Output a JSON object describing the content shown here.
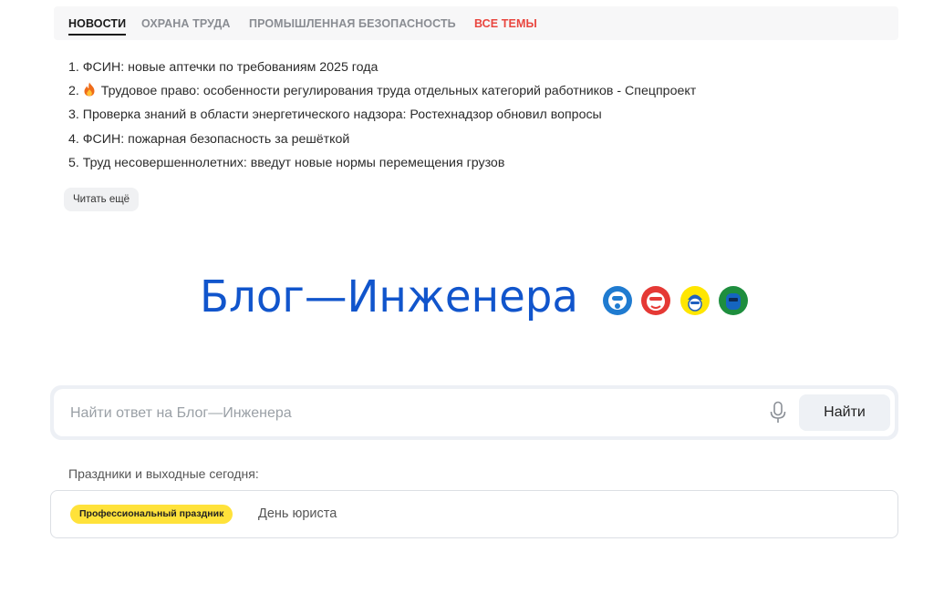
{
  "tabs": [
    {
      "label": "НОВОСТИ",
      "active": true
    },
    {
      "label": "ОХРАНА ТРУДА"
    },
    {
      "label": "ПРОМЫШЛЕННАЯ БЕЗОПАСНОСТЬ"
    },
    {
      "label": "ВСЕ ТЕМЫ",
      "accent_color": "#e9463f"
    }
  ],
  "news": [
    {
      "text": "1. ФСИН: новые аптечки по требованиям 2025 года"
    },
    {
      "text": "Трудовое право: особенности регулирования труда отдельных категорий работников - Спецпроект",
      "number": "2.",
      "icon": "fire-icon"
    },
    {
      "text": "3. Проверка знаний в области энергетического надзора: Ростехнадзор обновил вопросы"
    },
    {
      "text": "4. ФСИН: пожарная безопасность за решёткой"
    },
    {
      "text": "5. Труд несовершеннолетних: введут новые нормы перемещения грузов"
    }
  ],
  "read_more_label": "Читать ещё",
  "logo": {
    "text": "Блог—Инженера",
    "color": "#1155cc"
  },
  "avatars": [
    {
      "icon": "gasmask-avatar-icon",
      "color": "#1f7bd0"
    },
    {
      "icon": "face-shield-avatar-icon",
      "color": "#e53935"
    },
    {
      "icon": "hardhat-avatar-icon",
      "color": "#ffe600"
    },
    {
      "icon": "welding-mask-avatar-icon",
      "color": "#1e8e3e"
    }
  ],
  "search": {
    "placeholder": "Найти ответ на Блог—Инженера",
    "value": "",
    "button_label": "Найти",
    "mic_icon": "microphone-icon"
  },
  "holidays": {
    "label": "Праздники и выходные сегодня:",
    "items": [
      {
        "badge": "Профессиональный праздник",
        "name": "День юриста",
        "badge_color": "#ffe23a"
      }
    ]
  }
}
